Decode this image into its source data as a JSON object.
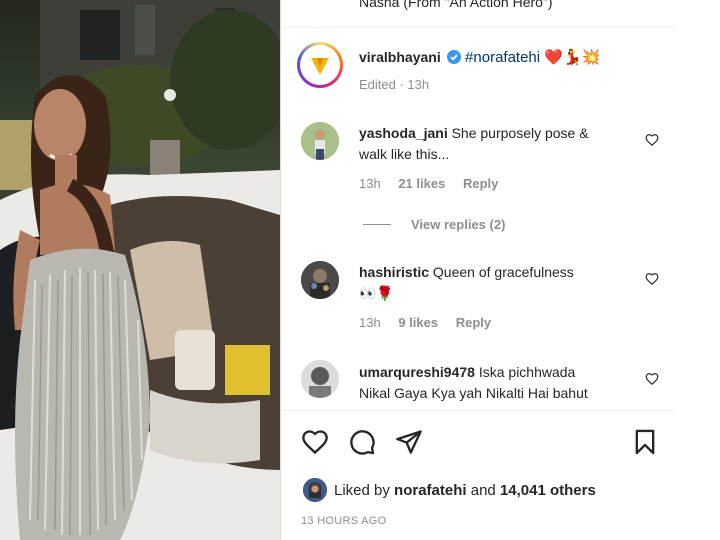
{
  "post": {
    "prev_caption_fragment": "Nasha (From \"An Action Hero\")",
    "author": "viralbhayani",
    "hashtag": "#norafatehi",
    "emojis": "❤️💃💥",
    "edited_meta": "Edited · 13h"
  },
  "comments": [
    {
      "username": "yashoda_jani",
      "text_line1": "She purposely pose &",
      "text_line2": "walk like this...",
      "time": "13h",
      "likes": "21 likes",
      "reply": "Reply",
      "view_replies": "View replies (2)"
    },
    {
      "username": "hashiristic",
      "text_line1": "Queen of gracefulness",
      "text_line2": "👀🌹",
      "time": "13h",
      "likes": "9 likes",
      "reply": "Reply"
    },
    {
      "username": "umarqureshi9478",
      "text_line1": "Iska pichhwada",
      "text_line2": "Nikal Gaya Kya yah Nikalti Hai bahut"
    }
  ],
  "likes_bar": {
    "liked_by_prefix": "Liked by",
    "liked_by_user": "norafatehi",
    "and_text": "and",
    "others_count": "14,041 others",
    "timestamp": "13 HOURS AGO"
  },
  "icons": {
    "like": "heart-outline-icon",
    "comment": "comment-bubble-icon",
    "share": "paper-plane-icon",
    "save": "bookmark-icon",
    "verified": "verified-badge-icon",
    "small_like": "heart-small-icon"
  },
  "colors": {
    "verified_blue": "#3897f0",
    "hashtag": "#00376b",
    "muted": "#8e8e8e",
    "text": "#262626"
  }
}
